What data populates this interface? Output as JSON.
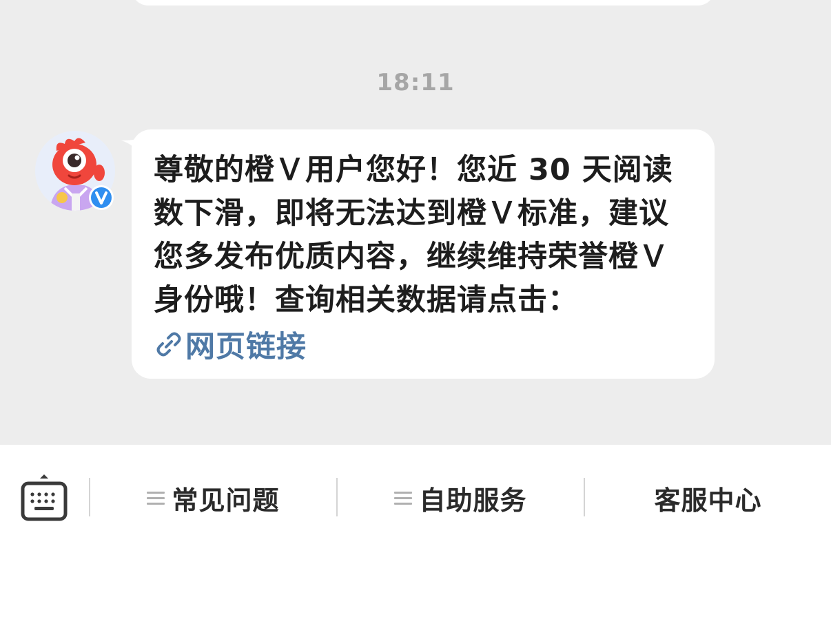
{
  "chat": {
    "timestamp": "18:11",
    "message": {
      "text": "尊敬的橙Ｖ用户您好！您近 30 天阅读数下滑，即将无法达到橙Ｖ标准，建议您多发布优质内容，继续维持荣誉橙Ｖ身份哦！查询相关数据请点击：",
      "link_label": "网页链接"
    },
    "avatar": {
      "icon": "mascot-avatar",
      "badge_icon": "verified-v-badge",
      "badge_letter": "V"
    }
  },
  "bottom_menu": {
    "keyboard_icon": "keyboard-icon",
    "items": [
      {
        "label": "常见问题",
        "icon": "menu-lines-icon"
      },
      {
        "label": "自助服务",
        "icon": "menu-lines-icon"
      },
      {
        "label": "客服中心"
      }
    ]
  },
  "colors": {
    "chat_background": "#ededed",
    "bubble": "#ffffff",
    "link": "#4f79a6",
    "badge": "#2f8ef0",
    "mascot": "#f0463c"
  }
}
